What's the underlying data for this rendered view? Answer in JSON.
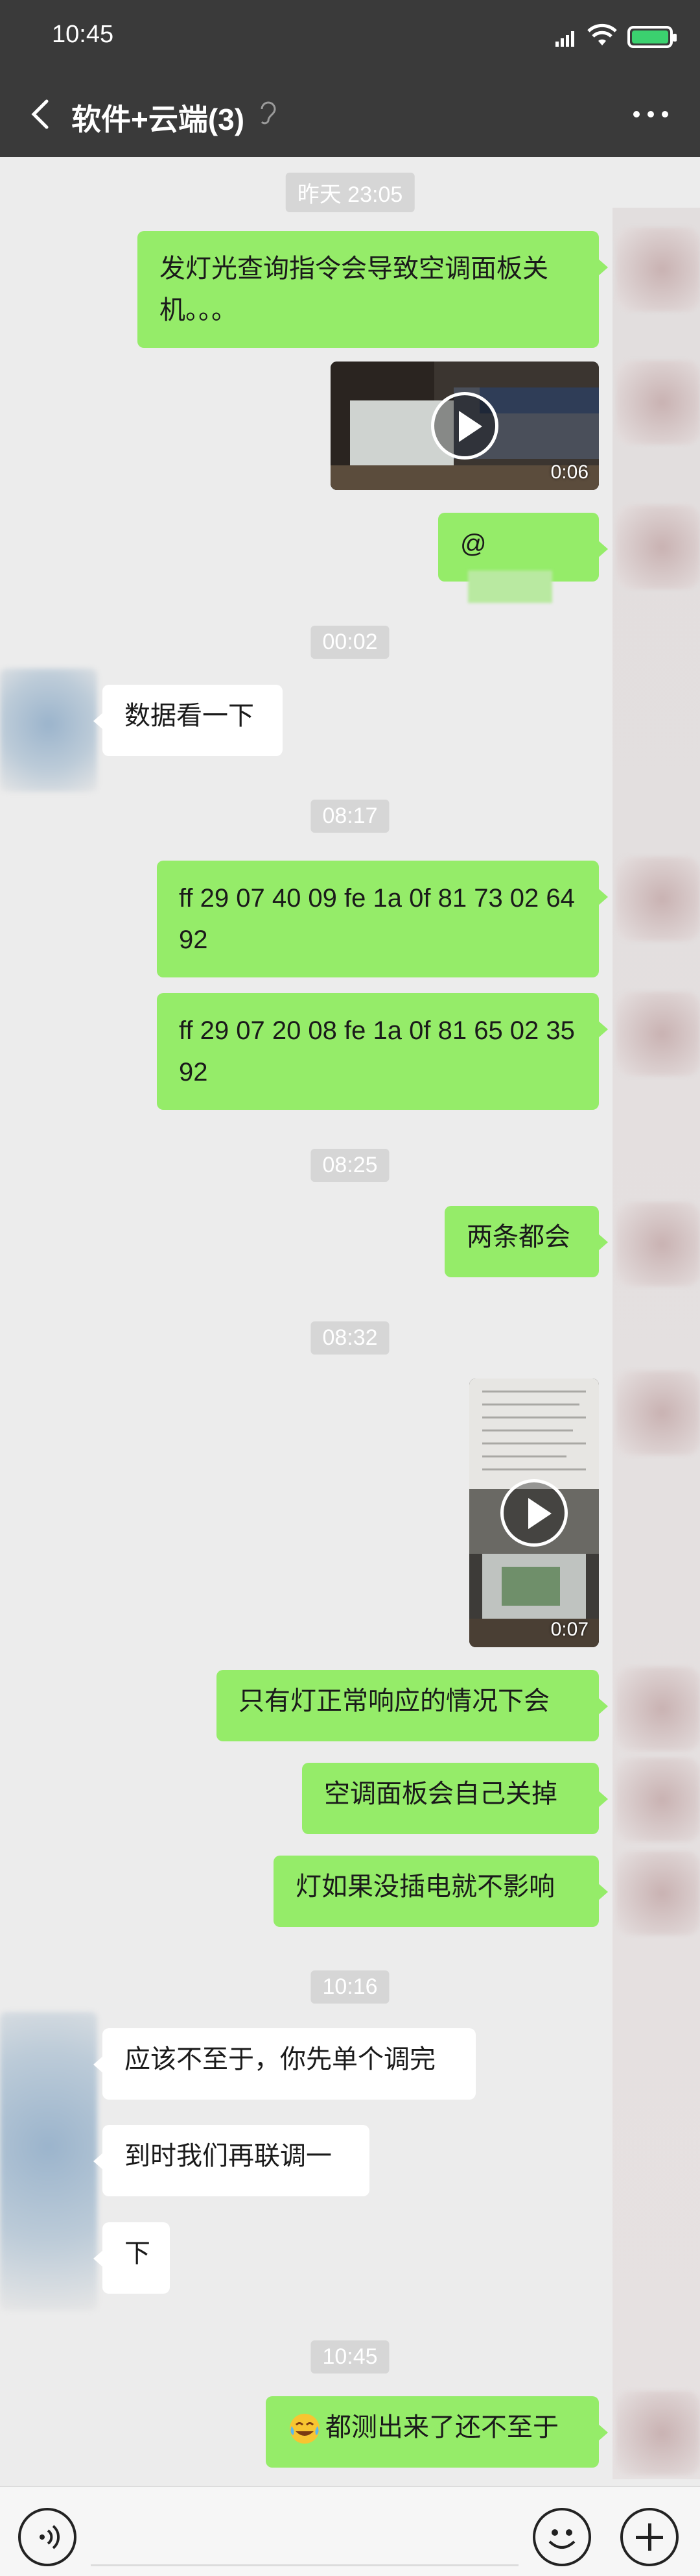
{
  "status_bar": {
    "time": "10:45"
  },
  "header": {
    "title": "软件+云端(3)"
  },
  "messages": {
    "ts1": "昨天 23:05",
    "m1": "发灯光查询指令会导致空调面板关机。。。",
    "video1_duration": "0:06",
    "m2": "@",
    "ts2": "00:02",
    "m3": "数据看一下",
    "ts3": "08:17",
    "m4": "ff 29 07 40 09 fe 1a 0f 81 73 02 64 92",
    "m5": "ff 29 07 20 08 fe 1a 0f 81 65 02 35 92",
    "ts4": "08:25",
    "m6": "两条都会",
    "ts5": "08:32",
    "video2_duration": "0:07",
    "m7": "只有灯正常响应的情况下会",
    "m8": "空调面板会自己关掉",
    "m9": "灯如果没插电就不影响",
    "ts6": "10:16",
    "m10": "应该不至于，你先单个调完",
    "m11": "到时我们再联调一",
    "m12": "下",
    "ts7": "10:45",
    "m13": "都测出来了还不至于"
  },
  "colors": {
    "bubble_me": "#95ec69",
    "bubble_them": "#ffffff",
    "bar": "#3a3a3a",
    "background": "#ececec"
  },
  "icons": {
    "back": "chevron-left-icon",
    "earpiece": "ear-icon",
    "more": "more-icon",
    "voice": "voice-icon",
    "emoji": "emoji-icon",
    "plus": "plus-icon"
  }
}
